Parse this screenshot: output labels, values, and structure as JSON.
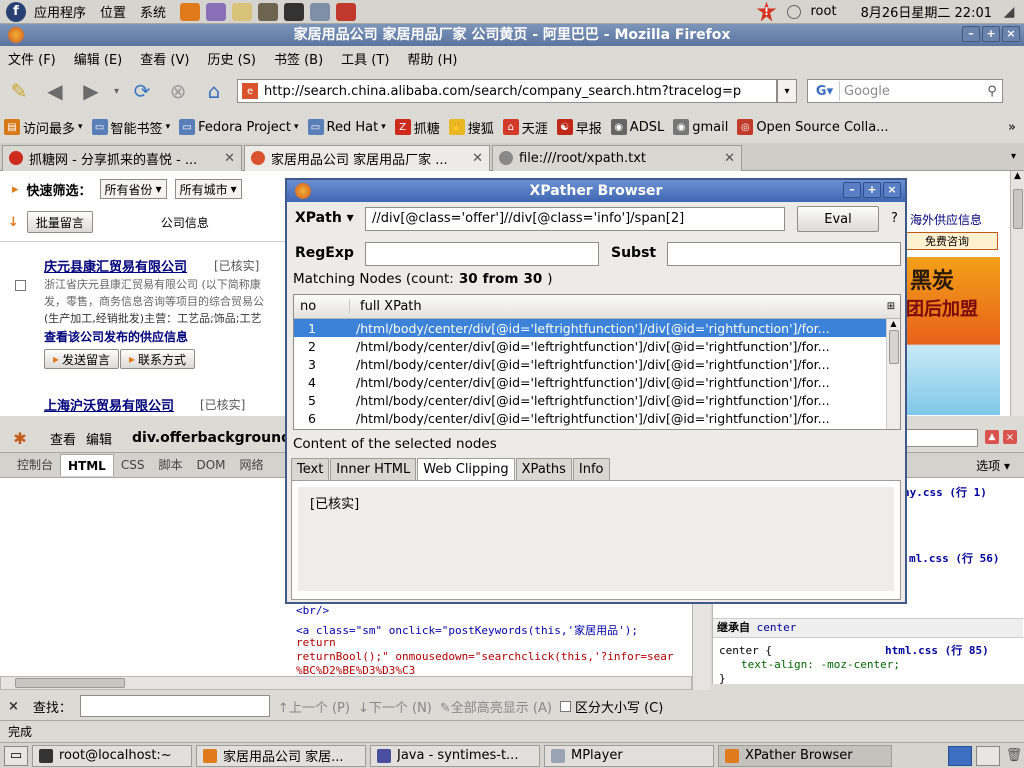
{
  "gnome_panel": {
    "menus": [
      "应用程序",
      "位置",
      "系统"
    ],
    "user": "root",
    "clock": "8月26日星期二 22:01",
    "launchers": [
      {
        "name": "firefox-launcher",
        "color": "#e07b1c"
      },
      {
        "name": "pidgin-launcher",
        "color": "#8b6fb8"
      },
      {
        "name": "editor-launcher",
        "color": "#d9c27a"
      },
      {
        "name": "gimp-launcher",
        "color": "#6d6452"
      },
      {
        "name": "terminal-launcher",
        "color": "#333333"
      },
      {
        "name": "mplayer-launcher",
        "color": "#7f8fa8"
      },
      {
        "name": "email-launcher",
        "color": "#c0392b"
      }
    ]
  },
  "firefox": {
    "title": "家居用品公司 家居用品厂家 公司黄页 - 阿里巴巴 - Mozilla Firefox",
    "menus": [
      "文件 (F)",
      "编辑 (E)",
      "查看 (V)",
      "历史 (S)",
      "书签 (B)",
      "工具 (T)",
      "帮助 (H)"
    ],
    "url": "http://search.china.alibaba.com/search/company_search.htm?tracelog=p",
    "search_placeholder": "Google",
    "bookmarks": [
      {
        "label": "访问最多",
        "color": "#d87a1a",
        "glyph": "▤",
        "arrow": true
      },
      {
        "label": "智能书签",
        "color": "#5a7fb8",
        "glyph": "▭",
        "arrow": true
      },
      {
        "label": "Fedora Project",
        "color": "#5a7fb8",
        "glyph": "▭",
        "arrow": true
      },
      {
        "label": "Red Hat",
        "color": "#5a7fb8",
        "glyph": "▭",
        "arrow": true
      },
      {
        "label": "抓糖",
        "color": "#cc2b1d",
        "glyph": "Z",
        "arrow": false
      },
      {
        "label": "搜狐",
        "color": "#e8b923",
        "glyph": "✋",
        "arrow": false
      },
      {
        "label": "天涯",
        "color": "#d23b2a",
        "glyph": "⌂",
        "arrow": false
      },
      {
        "label": "早报",
        "color": "#c0281a",
        "glyph": "☯",
        "arrow": false
      },
      {
        "label": "ADSL",
        "color": "#666666",
        "glyph": "◉",
        "arrow": false
      },
      {
        "label": "gmail",
        "color": "#777777",
        "glyph": "◉",
        "arrow": false
      },
      {
        "label": "Open Source Colla...",
        "color": "#c23b2a",
        "glyph": "◎",
        "arrow": false
      }
    ],
    "tabs": [
      {
        "label": "抓糖网 - 分享抓来的喜悦 - ...",
        "active": false,
        "icon_color": "#cc2b1d"
      },
      {
        "label": "家居用品公司 家居用品厂家 ...",
        "active": true,
        "icon_color": "#d9542c"
      },
      {
        "label": "file:///root/xpath.txt",
        "active": false,
        "icon_color": "#888888"
      }
    ],
    "status": "完成"
  },
  "page": {
    "filter_label": "快速筛选：",
    "province": "所有省份",
    "city": "所有城市",
    "batch_button": "批量留言",
    "company_info": "公司信息",
    "overseas": "海外供应信息",
    "free_consult": "免费咨询",
    "ad_text_1": "黑炭",
    "ad_text_2": "团后加盟",
    "companies": [
      {
        "name": "庆元县康汇贸易有限公司",
        "verified": "[已核实]",
        "desc1": "浙江省庆元县康汇贸易有限公司 (以下简称康",
        "desc2": "发，零售，商务信息咨询等项目的综合贸易公",
        "desc3": "(生产加工,经销批发)主营：工艺品;饰品;工艺",
        "supply": "查看该公司发布的供应信息",
        "msg": "发送留言",
        "contact": "联系方式"
      },
      {
        "name": "上海沪沃贸易有限公司",
        "verified": "[已核实]"
      }
    ]
  },
  "firebug": {
    "toolbar": [
      "查看",
      "编辑"
    ],
    "breadcrumb": "div.offerbackground",
    "tabs": [
      "控制台",
      "HTML",
      "CSS",
      "脚本",
      "DOM",
      "网络"
    ],
    "active_tab": "HTML",
    "options": "选项",
    "code_lines": [
      "<br/>",
      "<a class=\"sm\" onclick=\"postKeywords(this,'家居用品');",
      "return",
      "returnBool();\" onmousedown=\"searchclick(this,'?infor=sear",
      "%BC%D2%BE%D3%D3%C3"
    ],
    "right": {
      "css1": "ny.css (行 1)",
      "css2": "ml.css (行 56)",
      "inherit_label": "继承自",
      "inherit_from": "center",
      "css3": "html.css (行 85)",
      "rule_sel": "center {",
      "rule_prop": "text-align: -moz-center;",
      "rule_end": "}"
    }
  },
  "findbar": {
    "label": "查找：",
    "prev": "上一个 (P)",
    "next": "下一个 (N)",
    "highlight": "全部高亮显示 (A)",
    "match_case": "区分大小写 (C)"
  },
  "xpather": {
    "title": "XPather Browser",
    "xpath_label": "XPath",
    "xpath_value": "//div[@class='offer']//div[@class='info']/span[2]",
    "eval": "Eval",
    "help": "?",
    "regexp_label": "RegExp",
    "subst_label": "Subst",
    "matching_label": "Matching Nodes (count:",
    "count": "30",
    "from_word": "from",
    "total": "30",
    "close_paren": ")",
    "col_no": "no",
    "col_xpath": "full XPath",
    "rows": [
      {
        "no": "1",
        "path": "/html/body/center/div[@id='leftrightfunction']/div[@id='rightfunction']/for..."
      },
      {
        "no": "2",
        "path": "/html/body/center/div[@id='leftrightfunction']/div[@id='rightfunction']/for..."
      },
      {
        "no": "3",
        "path": "/html/body/center/div[@id='leftrightfunction']/div[@id='rightfunction']/for..."
      },
      {
        "no": "4",
        "path": "/html/body/center/div[@id='leftrightfunction']/div[@id='rightfunction']/for..."
      },
      {
        "no": "5",
        "path": "/html/body/center/div[@id='leftrightfunction']/div[@id='rightfunction']/for..."
      },
      {
        "no": "6",
        "path": "/html/body/center/div[@id='leftrightfunction']/div[@id='rightfunction']/for..."
      }
    ],
    "content_label": "Content of the selected nodes",
    "tabs": [
      "Text",
      "Inner HTML",
      "Web Clipping",
      "XPaths",
      "Info"
    ],
    "active_tab": "Web Clipping",
    "content": "[已核实]"
  },
  "taskbar": [
    {
      "label": "root@localhost:~",
      "active": false,
      "icon_color": "#333333"
    },
    {
      "label": "家居用品公司 家居...",
      "active": false,
      "icon_color": "#e07b1c"
    },
    {
      "label": "Java - syntimes-t...",
      "active": false,
      "icon_color": "#4a4fa0"
    },
    {
      "label": "MPlayer",
      "active": false,
      "icon_color": "#9aa4b4"
    },
    {
      "label": "XPather Browser",
      "active": true,
      "icon_color": "#e07b1c"
    }
  ]
}
